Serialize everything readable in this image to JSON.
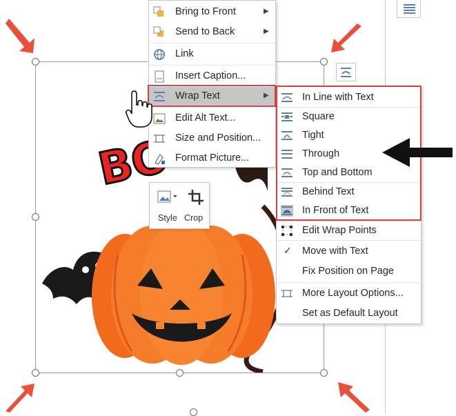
{
  "context_menu": {
    "items": [
      {
        "label": "Bring to Front",
        "icon": "bring-to-front-icon",
        "submenu": true
      },
      {
        "label": "Send to Back",
        "icon": "send-to-back-icon",
        "submenu": true
      },
      {
        "label": "Link",
        "icon": "link-icon",
        "submenu": false
      },
      {
        "label": "Insert Caption...",
        "icon": "insert-caption-icon",
        "submenu": false
      },
      {
        "label": "Wrap Text",
        "icon": "wrap-text-icon",
        "submenu": true,
        "highlighted": true
      },
      {
        "label": "Edit Alt Text...",
        "icon": "alt-text-icon",
        "submenu": false
      },
      {
        "label": "Size and Position...",
        "icon": "size-position-icon",
        "submenu": false
      },
      {
        "label": "Format Picture...",
        "icon": "format-picture-icon",
        "submenu": false
      }
    ]
  },
  "mini_toolbar": {
    "style_label": "Style",
    "crop_label": "Crop"
  },
  "wrap_submenu": {
    "items": [
      {
        "label": "In Line with Text",
        "icon": "inline-with-text-icon"
      },
      {
        "label": "Square",
        "icon": "square-wrap-icon"
      },
      {
        "label": "Tight",
        "icon": "tight-wrap-icon"
      },
      {
        "label": "Through",
        "icon": "through-wrap-icon"
      },
      {
        "label": "Top and Bottom",
        "icon": "top-bottom-wrap-icon"
      },
      {
        "label": "Behind Text",
        "icon": "behind-text-icon"
      },
      {
        "label": "In Front of Text",
        "icon": "in-front-of-text-icon",
        "selected": true
      },
      {
        "label": "Edit Wrap Points",
        "icon": "edit-wrap-points-icon"
      },
      {
        "label": "Move with Text",
        "icon": "checkmark-icon",
        "checked": true
      },
      {
        "label": "Fix Position on Page",
        "icon": ""
      },
      {
        "label": "More Layout Options...",
        "icon": "more-layout-options-icon"
      },
      {
        "label": "Set as Default Layout",
        "icon": ""
      }
    ]
  },
  "image": {
    "boo_text": "BOO"
  },
  "colors": {
    "accent_red": "#d94040",
    "highlight_gray": "#c6c6c6",
    "pumpkin_orange": "#f26b1d",
    "arrow_red": "#e8503a"
  }
}
